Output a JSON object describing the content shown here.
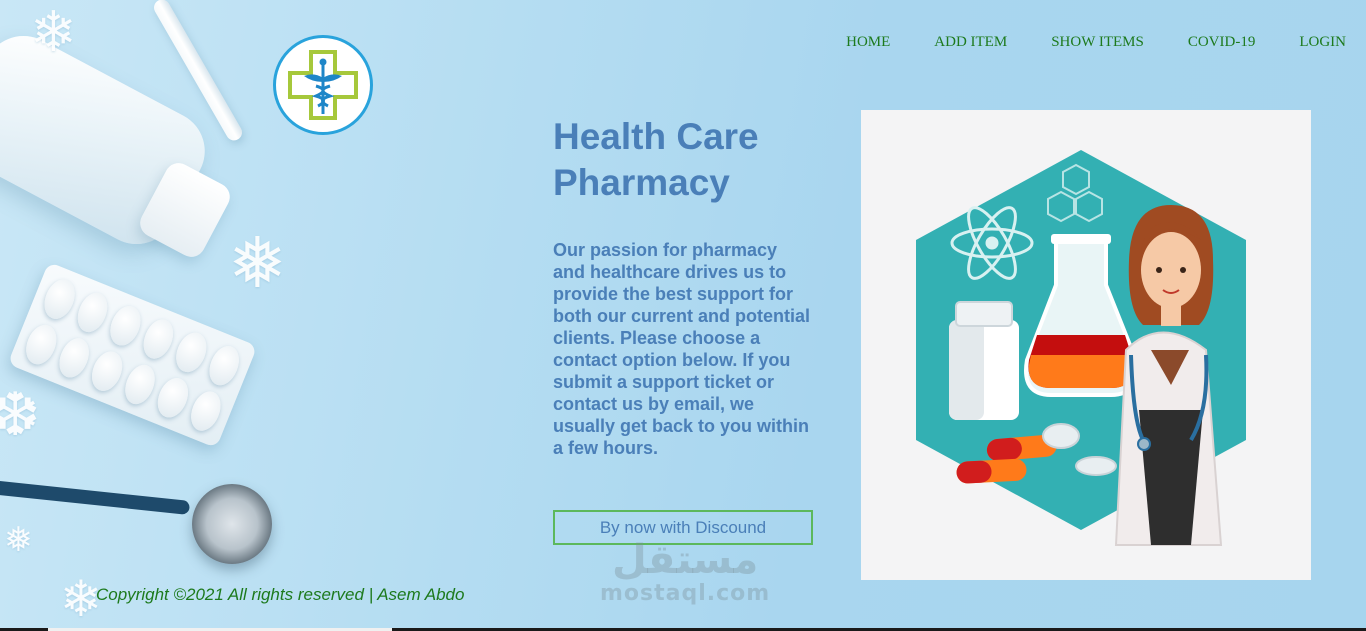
{
  "nav": {
    "items": [
      "HOME",
      "ADD ITEM",
      "SHOW ITEMS",
      "COVID-19",
      "LOGIN"
    ]
  },
  "hero": {
    "title_line1": "Health Care",
    "title_line2": "Pharmacy",
    "description": "Our passion for pharmacy and healthcare drives us to provide the best support for both our current and potential clients. Please choose a contact option below. If you submit a support ticket or contact us by email, we usually get back to you within a few hours.",
    "cta_label": "By now with Discound"
  },
  "footer": {
    "copyright": "Copyright ©2021 All rights reserved | Asem Abdo"
  },
  "watermark": {
    "arabic": "مستقل",
    "latin": "mostaql.com"
  },
  "icons": {
    "logo": "medical-caduceus-cross-logo",
    "illustration": "doctor-pharmacy-illustration"
  },
  "colors": {
    "nav_text": "#1d7a1d",
    "heading": "#4a7fb8",
    "button_border": "#5cb85c",
    "logo_ring": "#29a3dc",
    "logo_cross": "#a6c83b",
    "background": "#b3dcf1"
  }
}
